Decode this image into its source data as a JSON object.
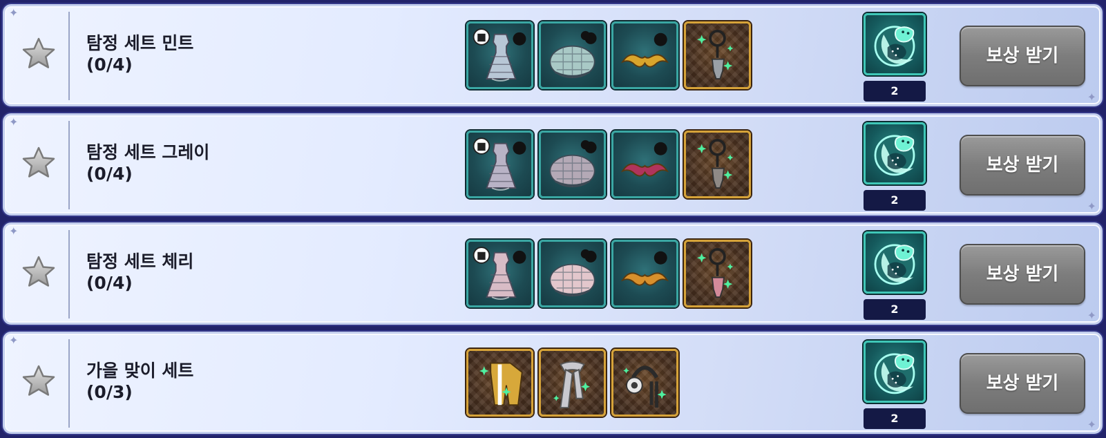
{
  "claim_label": "보상 받기",
  "sets": [
    {
      "title": "탐정 세트 민트",
      "progress": "(0/4)",
      "items": [
        {
          "icon": "dress-icon",
          "frame": "teal",
          "tint": "#b8c7d6"
        },
        {
          "icon": "beret-icon",
          "frame": "teal",
          "tint": "#a9c9c6"
        },
        {
          "icon": "mustache-icon",
          "frame": "teal",
          "tint": "#d9a52c"
        },
        {
          "icon": "magnifier-charm-icon",
          "frame": "gold",
          "tint": "#9aa0a6"
        }
      ],
      "reward": {
        "icon": "moon-creature-icon",
        "count": "2"
      }
    },
    {
      "title": "탐정 세트 그레이",
      "progress": "(0/4)",
      "items": [
        {
          "icon": "dress-icon",
          "frame": "teal",
          "tint": "#b9b3c6"
        },
        {
          "icon": "beret-icon",
          "frame": "teal",
          "tint": "#b4a9b6"
        },
        {
          "icon": "mustache-icon",
          "frame": "teal",
          "tint": "#b0345c"
        },
        {
          "icon": "magnifier-charm-icon",
          "frame": "gold",
          "tint": "#8f8a86"
        }
      ],
      "reward": {
        "icon": "moon-creature-icon",
        "count": "2"
      }
    },
    {
      "title": "탐정 세트 체리",
      "progress": "(0/4)",
      "items": [
        {
          "icon": "dress-icon",
          "frame": "teal",
          "tint": "#d8bcc6"
        },
        {
          "icon": "beret-icon",
          "frame": "teal",
          "tint": "#e3c7cc"
        },
        {
          "icon": "mustache-icon",
          "frame": "teal",
          "tint": "#d8902c"
        },
        {
          "icon": "magnifier-charm-icon",
          "frame": "gold",
          "tint": "#d48a9a"
        }
      ],
      "reward": {
        "icon": "moon-creature-icon",
        "count": "2"
      }
    },
    {
      "title": "가을 맞이 세트",
      "progress": "(0/3)",
      "items": [
        {
          "icon": "jacket-icon",
          "frame": "gold",
          "tint": "#d7a83a"
        },
        {
          "icon": "scarf-icon",
          "frame": "gold",
          "tint": "#c9c9cf"
        },
        {
          "icon": "earmuff-icon",
          "frame": "gold",
          "tint": "#2a2a2a"
        }
      ],
      "reward": {
        "icon": "moon-creature-icon",
        "count": "2"
      }
    }
  ]
}
